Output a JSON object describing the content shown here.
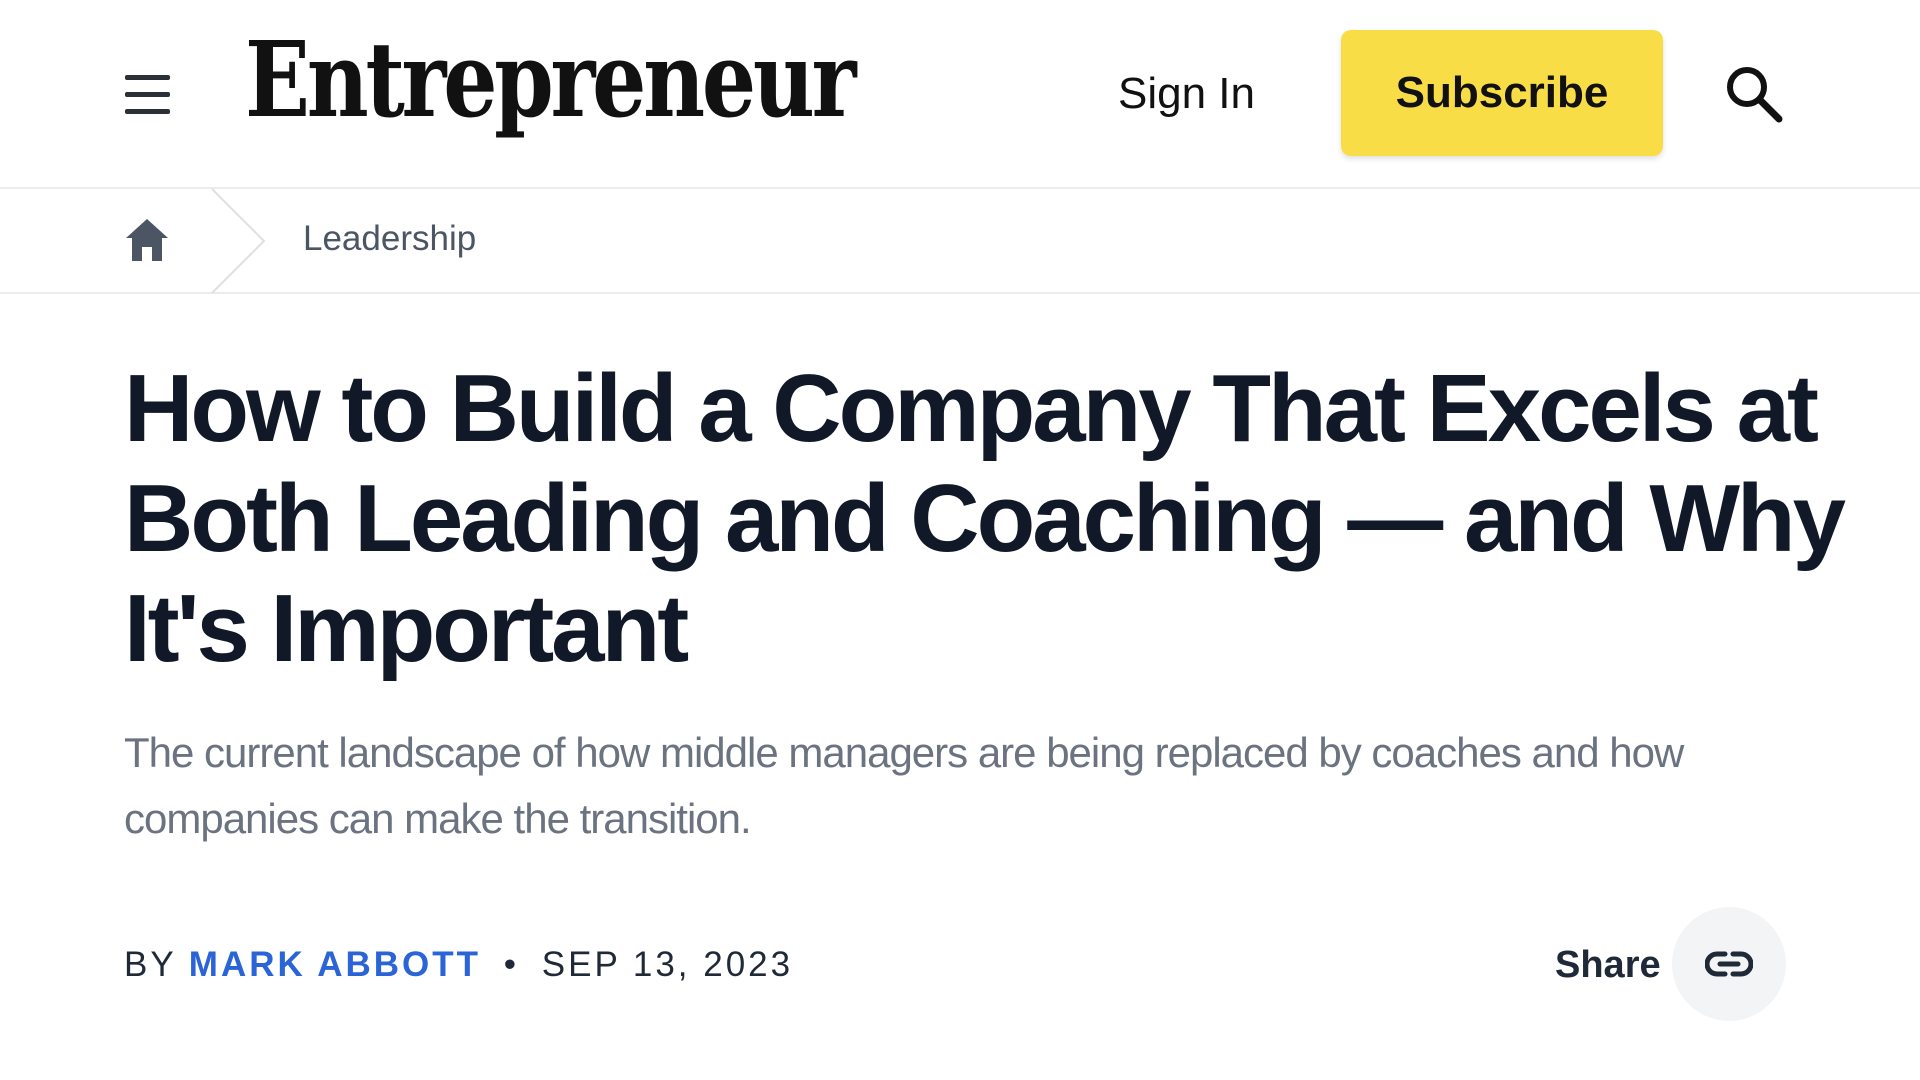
{
  "header": {
    "logo_text": "Entrepreneur",
    "sign_in_label": "Sign In",
    "subscribe_label": "Subscribe",
    "menu_icon": "hamburger-menu-icon",
    "search_icon": "search-icon"
  },
  "breadcrumb": {
    "home_icon": "home-icon",
    "items": [
      {
        "label": "Leadership"
      }
    ]
  },
  "article": {
    "headline": "How to Build a Company That Excels at Both Leading and Coaching — and Why It's Important",
    "dek": "The current landscape of how middle managers are being replaced by coaches and how companies can make the transition.",
    "byline_prefix": "BY",
    "author": "MARK ABBOTT",
    "separator": "•",
    "date": "SEP 13, 2023",
    "share_label": "Share",
    "share_icon": "link-icon"
  },
  "colors": {
    "subscribe_bg": "#f9dd47",
    "author_link": "#2a64d6",
    "headline_text": "#111827",
    "dek_text": "#6b7280",
    "share_bg": "#f3f4f6"
  }
}
